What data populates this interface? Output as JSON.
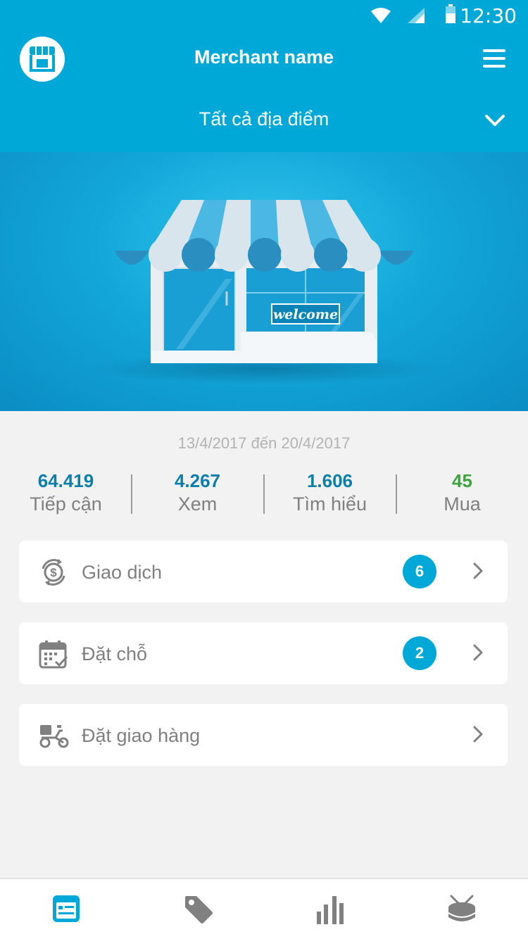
{
  "status_bar": {
    "time": "12:30"
  },
  "header": {
    "merchant_name": "Merchant name",
    "location": "Tất cả địa điểm",
    "logo_icon": "storefront-icon",
    "menu_icon": "hamburger-menu-icon"
  },
  "hero": {
    "sign_text": "welcome"
  },
  "date_range": "13/4/2017 đến 20/4/2017",
  "stats": [
    {
      "value": "64.419",
      "label": "Tiếp cận",
      "color": "#0a7fa9"
    },
    {
      "value": "4.267",
      "label": "Xem",
      "color": "#0a7fa9"
    },
    {
      "value": "1.606",
      "label": "Tìm hiểu",
      "color": "#0a7fa9"
    },
    {
      "value": "45",
      "label": "Mua",
      "color": "#3fa33f"
    }
  ],
  "cards": [
    {
      "label": "Giao dịch",
      "badge": "6",
      "icon": "money-exchange-icon"
    },
    {
      "label": "Đặt chỗ",
      "badge": "2",
      "icon": "calendar-check-icon"
    },
    {
      "label": "Đặt giao hàng",
      "badge": "",
      "icon": "delivery-motorbike-icon"
    }
  ],
  "bottom_nav": [
    {
      "icon": "dashboard-icon",
      "active": true
    },
    {
      "icon": "tag-icon",
      "active": false
    },
    {
      "icon": "bar-chart-icon",
      "active": false
    },
    {
      "icon": "drum-icon",
      "active": false
    }
  ],
  "colors": {
    "primary": "#00a8d8",
    "value_blue": "#0a7fa9",
    "value_green": "#3fa33f",
    "background": "#f2f2f2"
  }
}
